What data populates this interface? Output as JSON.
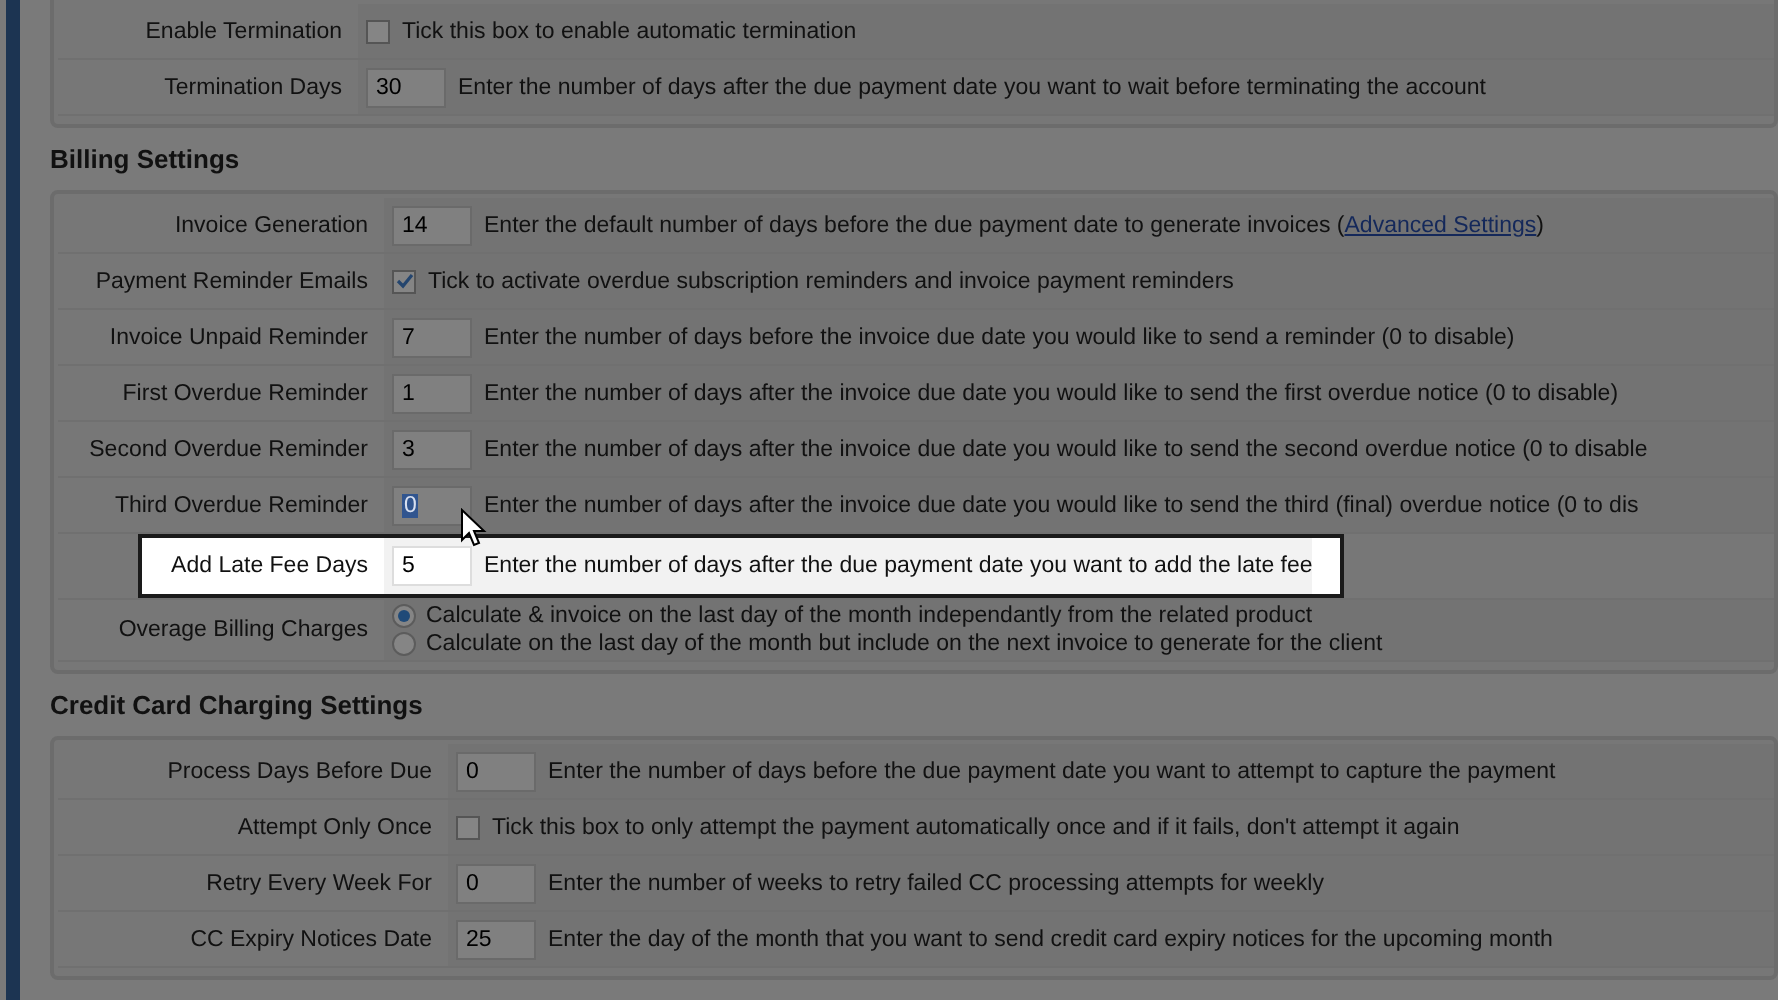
{
  "sections": [
    {
      "rows": [
        {
          "kind": "checkbox",
          "label": "Enable Termination",
          "checked": false,
          "highlighted": false,
          "description": "Tick this box to enable automatic termination"
        },
        {
          "kind": "text",
          "label": "Termination Days",
          "value": "30",
          "selected": false,
          "highlighted": false,
          "description": "Enter the number of days after the due payment date you want to wait before terminating the account"
        }
      ]
    },
    {
      "heading": "Billing Settings",
      "rows": [
        {
          "kind": "text",
          "label": "Invoice Generation",
          "value": "14",
          "selected": false,
          "highlighted": false,
          "description": "Enter the default number of days before the due payment date to generate invoices (",
          "link": "Advanced Settings",
          "description_end": ")"
        },
        {
          "kind": "checkbox",
          "label": "Payment Reminder Emails",
          "checked": true,
          "highlighted": false,
          "description": "Tick to activate overdue subscription reminders and invoice payment reminders"
        },
        {
          "kind": "text",
          "label": "Invoice Unpaid Reminder",
          "value": "7",
          "selected": false,
          "highlighted": false,
          "description": "Enter the number of days before the invoice due date you would like to send a reminder (0 to disable)"
        },
        {
          "kind": "text",
          "label": "First Overdue Reminder",
          "value": "1",
          "selected": false,
          "highlighted": false,
          "description": "Enter the number of days after the invoice due date you would like to send the first overdue notice (0 to disable)"
        },
        {
          "kind": "text",
          "label": "Second Overdue Reminder",
          "value": "3",
          "selected": false,
          "highlighted": false,
          "description": "Enter the number of days after the invoice due date you would like to send the second overdue notice (0 to disable"
        },
        {
          "kind": "text",
          "label": "Third Overdue Reminder",
          "value": "0",
          "selected": true,
          "highlighted": false,
          "description": "Enter the number of days after the invoice due date you would like to send the third (final) overdue notice (0 to dis"
        },
        {
          "kind": "text",
          "label": "Add Late Fee Days",
          "value": "5",
          "selected": false,
          "highlighted": true,
          "description": "Enter the number of days after the due payment date you want to add the late fee"
        },
        {
          "kind": "radios",
          "label": "Overage Billing Charges",
          "highlighted": false,
          "options": [
            {
              "label": "Calculate & invoice on the last day of the month independantly from the related product",
              "selected": true
            },
            {
              "label": "Calculate on the last day of the month but include on the next invoice to generate for the client",
              "selected": false
            }
          ]
        }
      ]
    },
    {
      "heading": "Credit Card Charging Settings",
      "rows": [
        {
          "kind": "text",
          "label": "Process Days Before Due",
          "value": "0",
          "selected": false,
          "highlighted": false,
          "description": "Enter the number of days before the due payment date you want to attempt to capture the payment"
        },
        {
          "kind": "checkbox",
          "label": "Attempt Only Once",
          "checked": false,
          "highlighted": false,
          "description": "Tick this box to only attempt the payment automatically once and if it fails, don't attempt it again"
        },
        {
          "kind": "text",
          "label": "Retry Every Week For",
          "value": "0",
          "selected": false,
          "highlighted": false,
          "description": "Enter the number of weeks to retry failed CC processing attempts for weekly"
        },
        {
          "kind": "text",
          "label": "CC Expiry Notices Date",
          "value": "25",
          "selected": false,
          "highlighted": false,
          "description": "Enter the day of the month that you want to send credit card expiry notices for the upcoming month"
        }
      ]
    }
  ]
}
